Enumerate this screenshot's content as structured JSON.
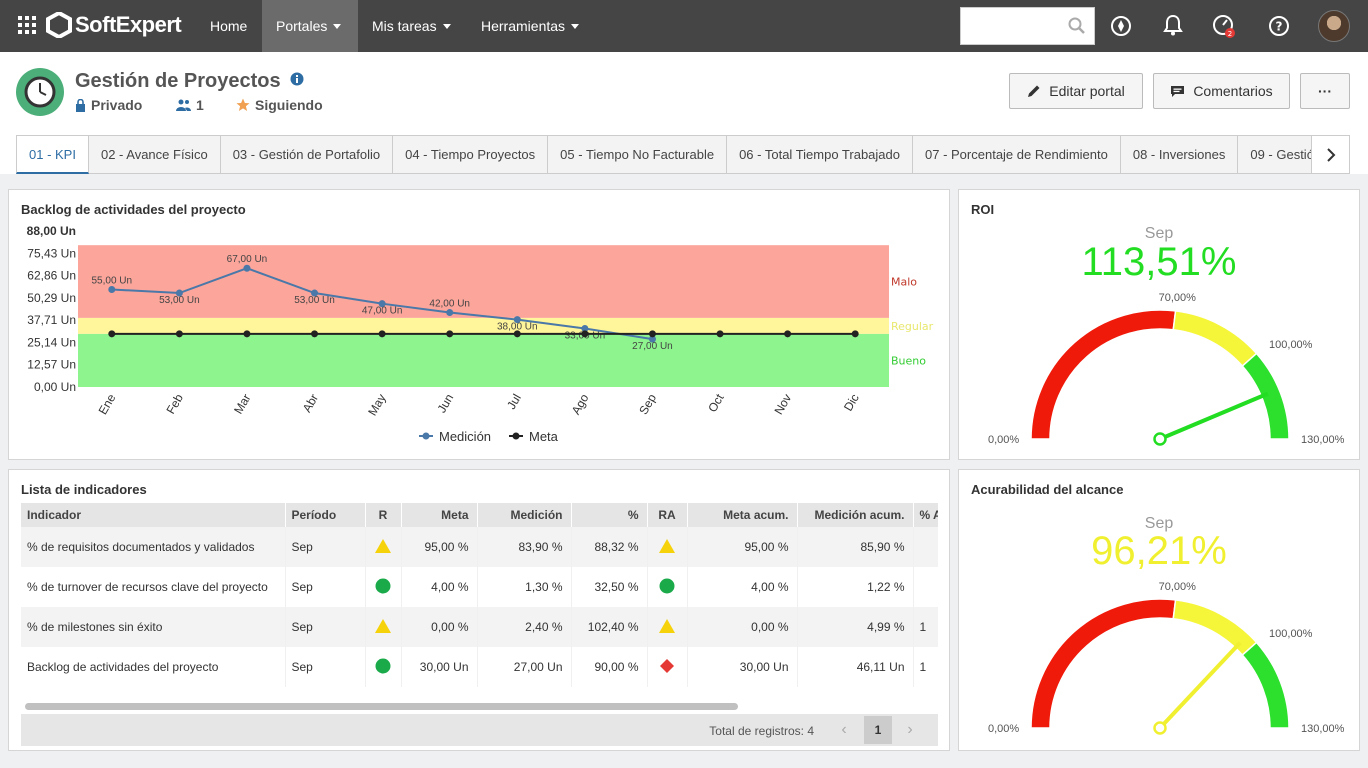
{
  "topbar": {
    "brand": "SoftExpert",
    "nav": [
      {
        "label": "Home",
        "dropdown": false,
        "active": false
      },
      {
        "label": "Portales",
        "dropdown": true,
        "active": true
      },
      {
        "label": "Mis tareas",
        "dropdown": true,
        "active": false
      },
      {
        "label": "Herramientas",
        "dropdown": true,
        "active": false
      }
    ],
    "icons": [
      "search-icon",
      "compass-icon",
      "bell-icon",
      "gauge-icon",
      "help-icon",
      "user-avatar"
    ]
  },
  "portal": {
    "title": "Gestión de Proyectos",
    "privacy": "Privado",
    "members": "1",
    "following": "Siguiendo",
    "buttons": {
      "edit": "Editar portal",
      "comments": "Comentarios",
      "more": "···"
    }
  },
  "tabs": [
    "01 - KPI",
    "02 - Avance Físico",
    "03 - Gestión de Portafolio",
    "04 - Tiempo Proyectos",
    "05 - Tiempo No Facturable",
    "06 - Total Tiempo Trabajado",
    "07 - Porcentaje de Rendimiento",
    "08 - Inversiones",
    "09 - Gestió"
  ],
  "backlog": {
    "title": "Backlog de actividades del proyecto",
    "chart_data": {
      "type": "line",
      "categories": [
        "Ene",
        "Feb",
        "Mar",
        "Abr",
        "May",
        "Jun",
        "Jul",
        "Ago",
        "Sep",
        "Oct",
        "Nov",
        "Dic"
      ],
      "y_ticks": [
        "0,00 Un",
        "12,57 Un",
        "25,14 Un",
        "37,71 Un",
        "50,29 Un",
        "62,86 Un",
        "75,43 Un",
        "88,00 Un"
      ],
      "ylim": [
        0,
        88
      ],
      "bands": [
        {
          "label": "Bueno",
          "from": 0,
          "to": 30,
          "color": "#8ef58e"
        },
        {
          "label": "Regular",
          "from": 30,
          "to": 39,
          "color": "#fff59a"
        },
        {
          "label": "Malo",
          "from": 39,
          "to": 80,
          "color": "#fba59b"
        }
      ],
      "series": [
        {
          "name": "Medición",
          "color": "#4a78a8",
          "values": [
            55,
            53,
            67,
            53,
            47,
            42,
            38,
            33,
            27,
            null,
            null,
            null
          ],
          "labels": [
            "55,00 Un",
            "53,00 Un",
            "67,00 Un",
            "53,00 Un",
            "47,00 Un",
            "42,00 Un",
            "38,00 Un",
            "33,00 Un",
            "27,00 Un",
            "",
            "",
            ""
          ]
        },
        {
          "name": "Meta",
          "color": "#222222",
          "values": [
            30,
            30,
            30,
            30,
            30,
            30,
            30,
            30,
            30,
            30,
            30,
            30
          ]
        }
      ]
    }
  },
  "roi": {
    "title": "ROI",
    "month": "Sep",
    "value": "113,51%",
    "value_color": "#22dd22",
    "gauge_data": {
      "type": "gauge",
      "min": 0,
      "max": 130,
      "value": 113.51,
      "thresholds": [
        70,
        100
      ],
      "labels": {
        "min": "0,00%",
        "t1": "70,00%",
        "t2": "100,00%",
        "max": "130,00%"
      },
      "needle_color": "#22dd22"
    }
  },
  "alcance": {
    "title": "Acurabilidad del alcance",
    "month": "Sep",
    "value": "96,21%",
    "value_color": "#f0f030",
    "gauge_data": {
      "type": "gauge",
      "min": 0,
      "max": 130,
      "value": 96.21,
      "thresholds": [
        70,
        100
      ],
      "labels": {
        "min": "0,00%",
        "t1": "70,00%",
        "t2": "100,00%",
        "max": "130,00%"
      },
      "needle_color": "#f0f030"
    }
  },
  "indicators": {
    "title": "Lista de indicadores",
    "columns": [
      "Indicador",
      "Período",
      "R",
      "Meta",
      "Medición",
      "%",
      "RA",
      "Meta acum.",
      "Medición acum.",
      "% A"
    ],
    "rows": [
      {
        "name": "% de requisitos documentados y validados",
        "period": "Sep",
        "r": "warning",
        "meta": "95,00 %",
        "medicion": "83,90 %",
        "pct": "88,32 %",
        "ra": "warning",
        "meta_acum": "95,00 %",
        "med_acum": "85,90 %",
        "pct_acum": ""
      },
      {
        "name": "% de turnover de recursos clave del proyecto",
        "period": "Sep",
        "r": "ok",
        "meta": "4,00 %",
        "medicion": "1,30 %",
        "pct": "32,50 %",
        "ra": "ok",
        "meta_acum": "4,00 %",
        "med_acum": "1,22 %",
        "pct_acum": ""
      },
      {
        "name": "% de milestones sin éxito",
        "period": "Sep",
        "r": "warning",
        "meta": "0,00 %",
        "medicion": "2,40 %",
        "pct": "102,40 %",
        "ra": "warning",
        "meta_acum": "0,00 %",
        "med_acum": "4,99 %",
        "pct_acum": "1"
      },
      {
        "name": "Backlog de actividades del proyecto",
        "period": "Sep",
        "r": "ok",
        "meta": "30,00 Un",
        "medicion": "27,00 Un",
        "pct": "90,00 %",
        "ra": "bad",
        "meta_acum": "30,00 Un",
        "med_acum": "46,11 Un",
        "pct_acum": "1"
      }
    ],
    "footer": {
      "total": "Total de registros: 4",
      "page": "1"
    }
  }
}
